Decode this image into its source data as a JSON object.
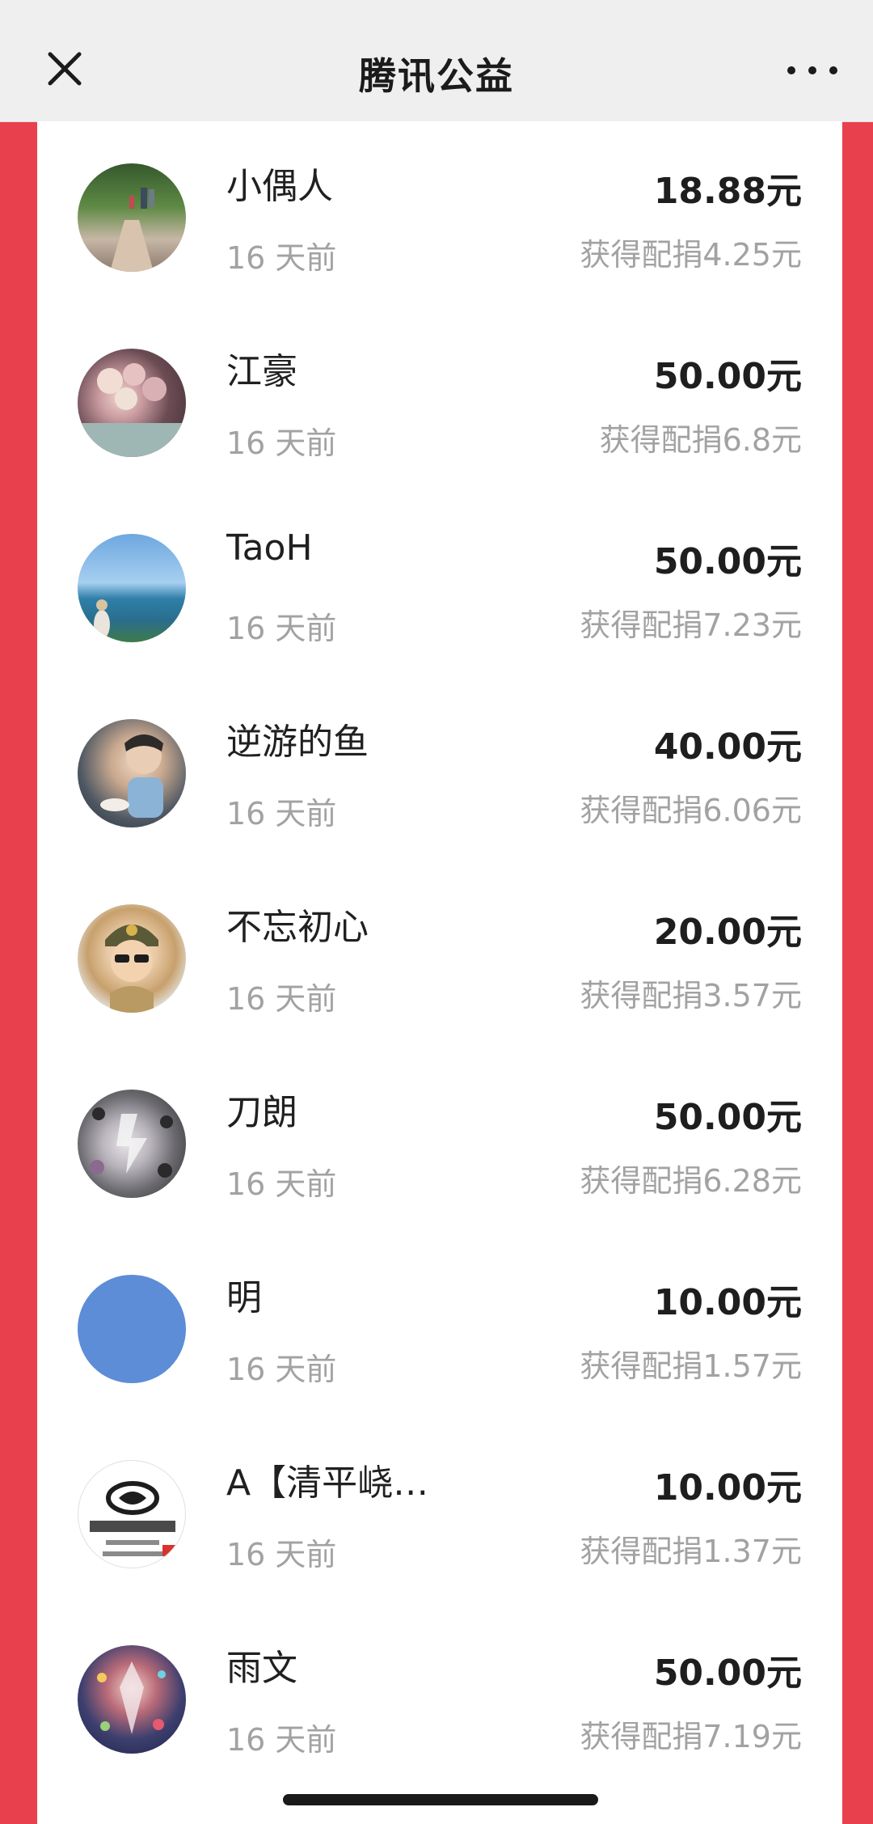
{
  "header": {
    "title": "腾讯公益",
    "close_icon": "close-icon",
    "more_icon": "more-dots-icon"
  },
  "colors": {
    "background_red": "#e8414d",
    "card_white": "#ffffff",
    "header_gray": "#efefef"
  },
  "donations": [
    {
      "name": "小偶人",
      "time": "16 天前",
      "amount": "18.88元",
      "match": "获得配捐4.25元"
    },
    {
      "name": "江豪",
      "time": "16 天前",
      "amount": "50.00元",
      "match": "获得配捐6.8元"
    },
    {
      "name": "TaoH",
      "time": "16 天前",
      "amount": "50.00元",
      "match": "获得配捐7.23元"
    },
    {
      "name": "逆游的鱼",
      "time": "16 天前",
      "amount": "40.00元",
      "match": "获得配捐6.06元"
    },
    {
      "name": "不忘初心",
      "time": "16 天前",
      "amount": "20.00元",
      "match": "获得配捐3.57元"
    },
    {
      "name": "刀朗",
      "time": "16 天前",
      "amount": "50.00元",
      "match": "获得配捐6.28元"
    },
    {
      "name": "明",
      "time": "16 天前",
      "amount": "10.00元",
      "match": "获得配捐1.57元"
    },
    {
      "name": "A【清平峣…",
      "time": "16 天前",
      "amount": "10.00元",
      "match": "获得配捐1.37元"
    },
    {
      "name": "雨文",
      "time": "16 天前",
      "amount": "50.00元",
      "match": "获得配捐7.19元"
    }
  ]
}
